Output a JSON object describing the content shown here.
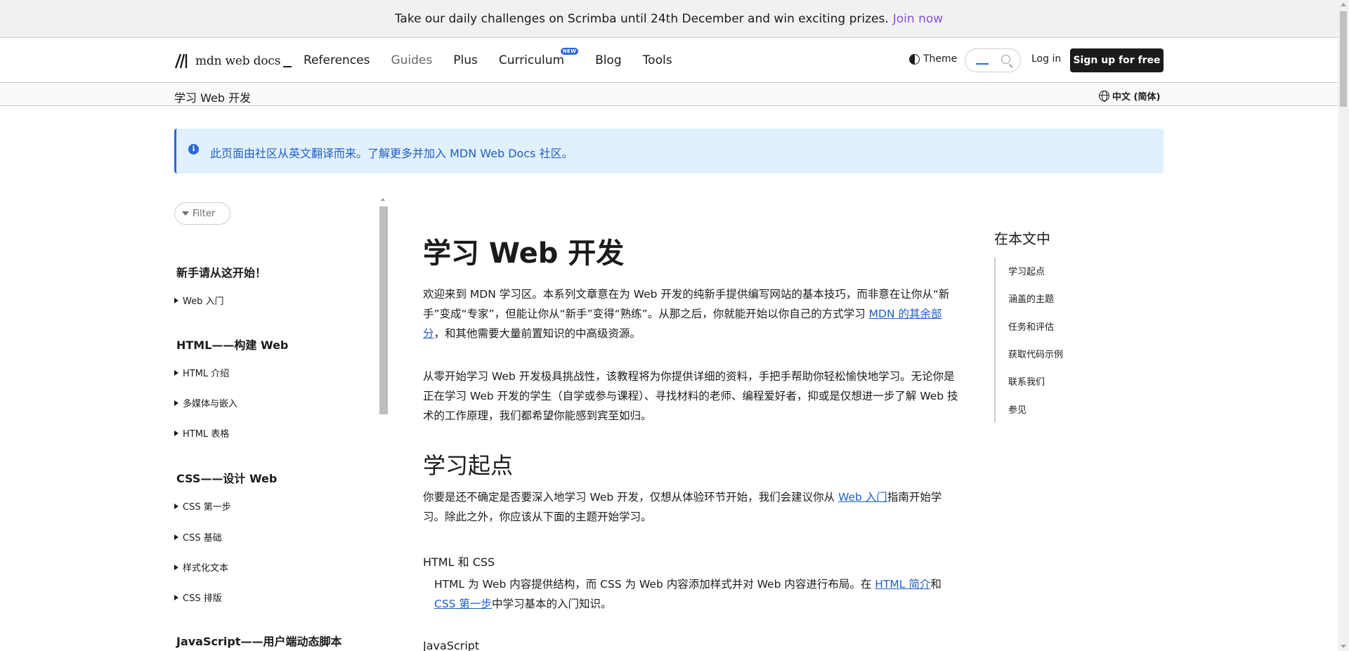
{
  "banner": {
    "text": "Take our daily challenges on Scrimba until 24th December and win exciting prizes.",
    "link": "Join now"
  },
  "header": {
    "logo_text": "mdn web docs",
    "nav": [
      {
        "label": "References"
      },
      {
        "label": "Guides"
      },
      {
        "label": "Plus"
      },
      {
        "label": "Curriculum",
        "badge": "NEW"
      },
      {
        "label": "Blog"
      },
      {
        "label": "Tools"
      }
    ],
    "theme_label": "Theme",
    "login_label": "Log in",
    "signup_label": "Sign up for free"
  },
  "breadcrumb": {
    "label": "学习 Web 开发"
  },
  "language": {
    "label": "中文 (简体)"
  },
  "notice": {
    "text": "此页面由社区从英文翻译而来。了解更多并加入 MDN Web Docs 社区。"
  },
  "sidebar": {
    "filter_label": "Filter",
    "sections": [
      {
        "heading": "新手请从这开始！",
        "items": [
          "Web 入门"
        ]
      },
      {
        "heading": "HTML——构建 Web",
        "items": [
          "HTML 介绍",
          "多媒体与嵌入",
          "HTML 表格"
        ]
      },
      {
        "heading": "CSS——设计 Web",
        "items": [
          "CSS 第一步",
          "CSS 基础",
          "样式化文本",
          "CSS 排版"
        ]
      },
      {
        "heading": "JavaScript——用户端动态脚本",
        "items": []
      }
    ]
  },
  "article": {
    "title": "学习 Web 开发",
    "p1": {
      "text": "欢迎来到 MDN 学习区。本系列文章意在为 Web 开发的纯新手提供编写网站的基本技巧，而非意在让你从“新手”变成“专家”，但能让你从“新手”变得“熟练”。从那之后，你就能开始以你自己的方式学习 ",
      "link": "MDN 的其余部分",
      "tail": "，和其他需要大量前置知识的中高级资源。"
    },
    "p2": "从零开始学习 Web 开发极具挑战性，该教程将为你提供详细的资料，手把手帮助你轻松愉快地学习。无论你是正在学习 Web 开发的学生（自学或参与课程）、寻找材料的老师、编程爱好者，抑或是仅想进一步了解 Web 技术的工作原理，我们都希望你能感到宾至如归。",
    "h2": "学习起点",
    "p3": {
      "text": "你要是还不确定是否要深入地学习 Web 开发，仅想从体验环节开始，我们会建议你从 ",
      "link": "Web 入门",
      "tail": "指南开始学习。除此之外，你应该从下面的主题开始学习。"
    },
    "h3_html_css": "HTML 和 CSS",
    "p4": {
      "text": "HTML 为 Web 内容提供结构，而 CSS 为 Web 内容添加样式并对 Web 内容进行布局。在 ",
      "link1": "HTML 简介",
      "mid": "和",
      "link2": "CSS 第一步",
      "tail": "中学习基本的入门知识。"
    },
    "h3_js": "JavaScript"
  },
  "toc": {
    "title": "在本文中",
    "items": [
      "学习起点",
      "涵盖的主题",
      "任务和评估",
      "获取代码示例",
      "联系我们",
      "参见"
    ]
  },
  "colors": {
    "accent": "#2c68d6",
    "link": "#1f5fc4",
    "notice_bg": "#e1f0fd",
    "join_link": "#8a4fe0",
    "signup_bg": "#1b1b1b"
  }
}
